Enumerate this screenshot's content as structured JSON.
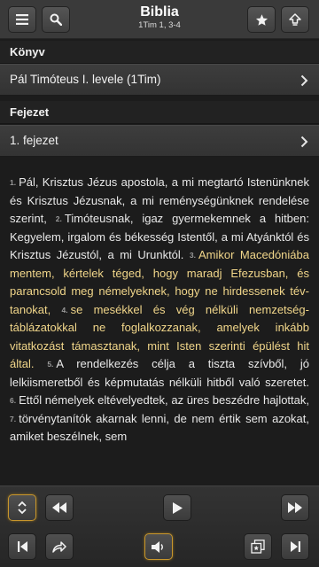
{
  "header": {
    "title": "Biblia",
    "reference": "1Tim 1, 3-4",
    "icons": [
      "menu-icon",
      "search-icon",
      "star-icon",
      "upload-icon"
    ]
  },
  "book": {
    "section_label": "Könyv",
    "selected": "Pál Timóteus I. levele (1Tim)"
  },
  "chapter": {
    "section_label": "Fejezet",
    "selected": "1. fejezet"
  },
  "passage": {
    "verses": [
      {
        "n": "1.",
        "text": "Pál, Krisztus Jézus apostola, a mi megtartó Iste­nünknek és Krisztus Jézusnak, a mi reménysé­günknek rendelése szerint,",
        "highlight": false
      },
      {
        "n": "2.",
        "text": "Timóteusnak, igaz gyermekemnek a hitben: Kegyelem, irgalom és bé­kesség Istentől, a mi Atyánktól és Krisztus Jézus­tól, a mi Urunktól.",
        "highlight": false
      },
      {
        "n": "3.",
        "text": "Amikor Macedóniába mentem, kértelek téged, hogy maradj Efezusban, és paran­csold meg némelyeknek, hogy ne hirdessenek tév­tanokat,",
        "highlight": true
      },
      {
        "n": "4.",
        "text": "se mesékkel és vég nélküli nemzetség­táblázatokkal ne foglalkozzanak, amelyek inkább vitatkozást támasztanak, mint Isten szerinti épülést hit által.",
        "highlight": true
      },
      {
        "n": "5.",
        "text": "A rendelkezés célja a tiszta szívből, jó lelkiismeretből és képmutatás nélküli hitből való szeretet.",
        "highlight": false
      },
      {
        "n": "6.",
        "text": "Ettől némelyek eltévelyedtek, az üres beszédre hajlottak,",
        "highlight": false
      },
      {
        "n": "7.",
        "text": "törvénytanítók akarnak lenni, de nem értik sem azokat, amiket beszélnek, sem",
        "highlight": false
      }
    ]
  },
  "toolbar": {
    "icons": [
      "expand-collapse-icon",
      "rewind-icon",
      "play-icon",
      "fast-forward-icon",
      "skip-back-icon",
      "share-icon",
      "volume-icon",
      "bookmarks-icon",
      "skip-forward-icon"
    ]
  }
}
